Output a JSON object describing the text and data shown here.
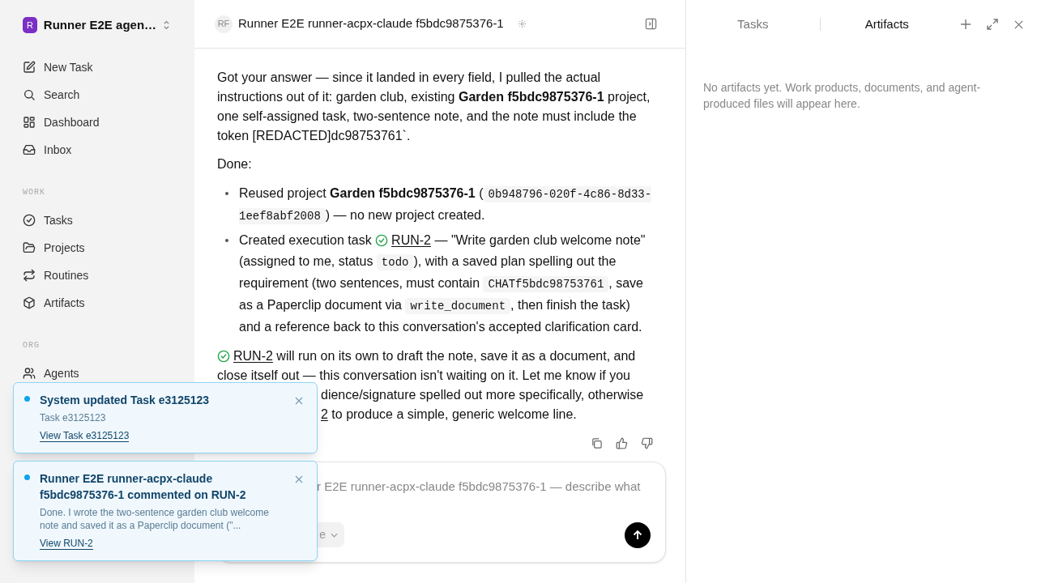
{
  "workspace": {
    "initial": "R",
    "name": "Runner E2E agen…"
  },
  "sidebar": {
    "top_items": [
      {
        "label": "New Task"
      },
      {
        "label": "Search"
      },
      {
        "label": "Dashboard"
      },
      {
        "label": "Inbox"
      }
    ],
    "sections": [
      {
        "heading": "WORK",
        "items": [
          {
            "label": "Tasks"
          },
          {
            "label": "Projects"
          },
          {
            "label": "Routines"
          },
          {
            "label": "Artifacts"
          }
        ]
      },
      {
        "heading": "ORG",
        "items": [
          {
            "label": "Agents"
          }
        ]
      }
    ]
  },
  "conversation": {
    "avatar": "RF",
    "title": "Runner E2E runner-acpx-claude f5bdc9875376-1",
    "blocks": [
      {
        "kind": "paragraph",
        "segments": [
          {
            "kind": "text",
            "text": "Got your answer — since it landed in every field, I pulled the actual instructions out of it: garden club, existing **Garden f5bdc9875376-1** project, one self-assigned task, two-sentence note, and the note must include the token [REDACTED]dc98753761`."
          }
        ]
      },
      {
        "kind": "paragraph",
        "segments": [
          {
            "kind": "text",
            "text": "Done:"
          }
        ]
      },
      {
        "kind": "bullets",
        "items": [
          [
            {
              "kind": "text",
              "text": "Reused project **Garden f5bdc9875376-1** ("
            },
            {
              "kind": "code",
              "text": "0b948796-020f-4c86-8d33-1eef8abf2008"
            },
            {
              "kind": "text",
              "text": ") — no new project created."
            }
          ],
          [
            {
              "kind": "text",
              "text": "Created execution task "
            },
            {
              "kind": "status"
            },
            {
              "kind": "link",
              "text": "RUN-2"
            },
            {
              "kind": "text",
              "text": " — \"Write garden club welcome note\" (assigned to me, status "
            },
            {
              "kind": "code",
              "text": "todo"
            },
            {
              "kind": "text",
              "text": "), with a saved plan spelling out the requirement (two sentences, must contain "
            },
            {
              "kind": "code",
              "text": "CHATf5bdc98753761"
            },
            {
              "kind": "text",
              "text": ", save as a Paperclip document via "
            },
            {
              "kind": "code",
              "text": "write_document"
            },
            {
              "kind": "text",
              "text": ", then finish the task) and a reference back to this conversation's accepted clarification card."
            }
          ]
        ]
      },
      {
        "kind": "paragraph",
        "segments": [
          {
            "kind": "status"
          },
          {
            "kind": "link",
            "text": "RUN-2"
          },
          {
            "kind": "text",
            "text": " will run on its own to draft the note, save it as a document, and close itself out — this conversation isn't waiting on it. Let me know if you"
          }
        ]
      },
      {
        "kind": "partial",
        "segments": [
          {
            "kind": "text",
            "text": "dience/signature spelled out more specifically, otherwise"
          }
        ]
      },
      {
        "kind": "partial",
        "segments": [
          {
            "kind": "link",
            "text": "2"
          },
          {
            "kind": "text",
            "text": " to produce a simple, generic welcome line."
          }
        ]
      }
    ]
  },
  "composer": {
    "placeholder": "r E2E runner-acpx-claude f5bdc9875376-1 — describe what",
    "chip": "e"
  },
  "panel": {
    "tabs": [
      {
        "label": "Tasks",
        "selected": false
      },
      {
        "label": "Artifacts",
        "selected": true
      }
    ],
    "empty_text": "No artifacts yet. Work products, documents, and agent-produced files will appear here."
  },
  "toasts": [
    {
      "title": "System updated Task e3125123",
      "body": "Task e3125123",
      "link": "View Task e3125123",
      "unread": true
    },
    {
      "title": "Runner E2E runner-acpx-claude f5bdc9875376-1 commented on RUN-2",
      "body": "Done. I wrote the two-sentence garden club welcome note and saved it as a Paperclip document (\"...",
      "link": "View RUN-2",
      "unread": true
    }
  ]
}
